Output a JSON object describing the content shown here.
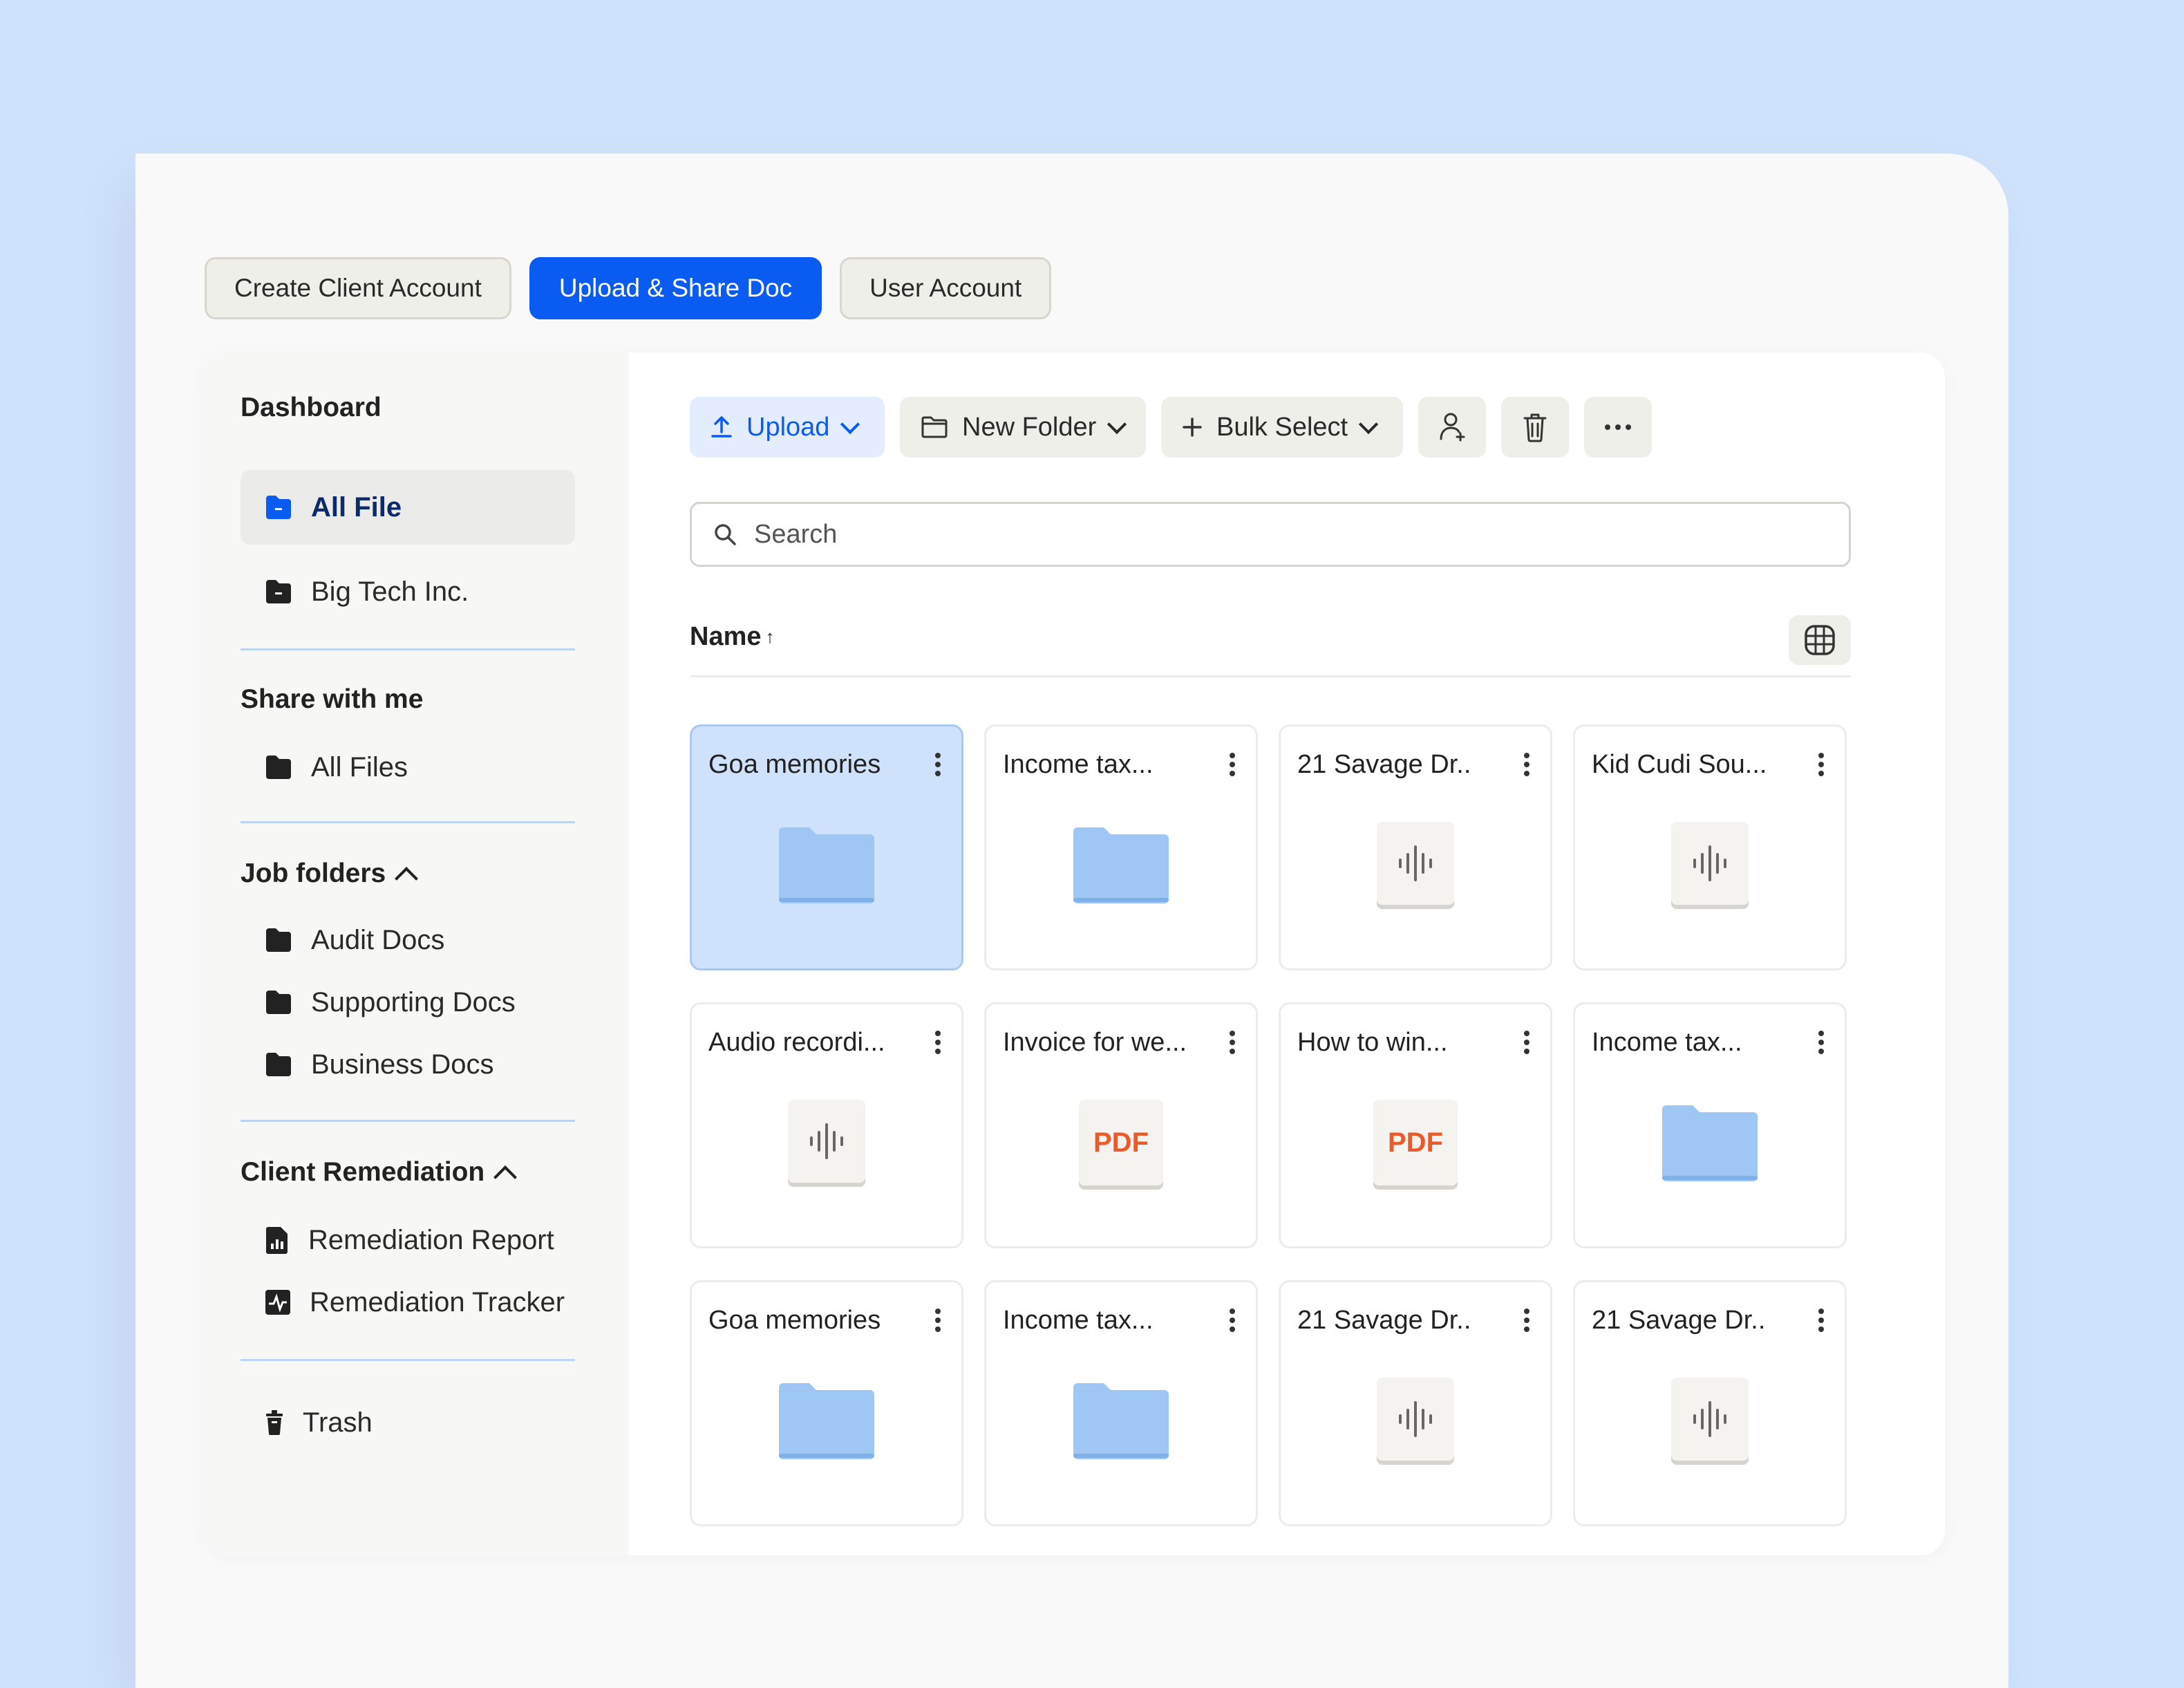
{
  "top_tabs": [
    {
      "label": "Create Client Account"
    },
    {
      "label": "Upload & Share Doc"
    },
    {
      "label": "User Account"
    }
  ],
  "sidebar": {
    "dashboard_heading": "Dashboard",
    "dashboard_items": [
      {
        "label": "All File",
        "icon": "folder-icon"
      },
      {
        "label": "Big Tech Inc.",
        "icon": "folder-icon"
      }
    ],
    "share_heading": "Share with me",
    "share_items": [
      {
        "label": "All Files",
        "icon": "folder-icon"
      }
    ],
    "job_heading": "Job folders",
    "job_items": [
      {
        "label": "Audit Docs",
        "icon": "folder-icon"
      },
      {
        "label": "Supporting Docs",
        "icon": "folder-icon"
      },
      {
        "label": "Business Docs",
        "icon": "folder-icon"
      }
    ],
    "remediation_heading": "Client Remediation",
    "remediation_items": [
      {
        "label": "Remediation Report",
        "icon": "report-icon"
      },
      {
        "label": "Remediation Tracker",
        "icon": "tracker-icon"
      }
    ],
    "trash_label": "Trash"
  },
  "toolbar": {
    "upload_label": "Upload",
    "new_folder_label": "New Folder",
    "bulk_select_label": "Bulk Select"
  },
  "search": {
    "placeholder": "Search"
  },
  "list": {
    "sort_label": "Name",
    "sort_arrow": "↑"
  },
  "files": [
    {
      "name": "Goa memories",
      "type": "folder"
    },
    {
      "name": "Income tax...",
      "type": "folder"
    },
    {
      "name": "21 Savage Dr..",
      "type": "audio"
    },
    {
      "name": "Kid Cudi Sou...",
      "type": "audio"
    },
    {
      "name": "Audio recordi...",
      "type": "audio"
    },
    {
      "name": "Invoice for we...",
      "type": "pdf",
      "badge": "PDF"
    },
    {
      "name": "How to win...",
      "type": "pdf",
      "badge": "PDF"
    },
    {
      "name": "Income tax...",
      "type": "folder"
    },
    {
      "name": "Goa memories",
      "type": "folder"
    },
    {
      "name": "Income tax...",
      "type": "folder"
    },
    {
      "name": "21 Savage Dr..",
      "type": "audio"
    },
    {
      "name": "21 Savage Dr..",
      "type": "audio"
    }
  ],
  "colors": {
    "accent": "#0a5bf2",
    "background": "#cfe2fb",
    "folder": "#9fc7f5",
    "pdf": "#ea5a2a"
  }
}
